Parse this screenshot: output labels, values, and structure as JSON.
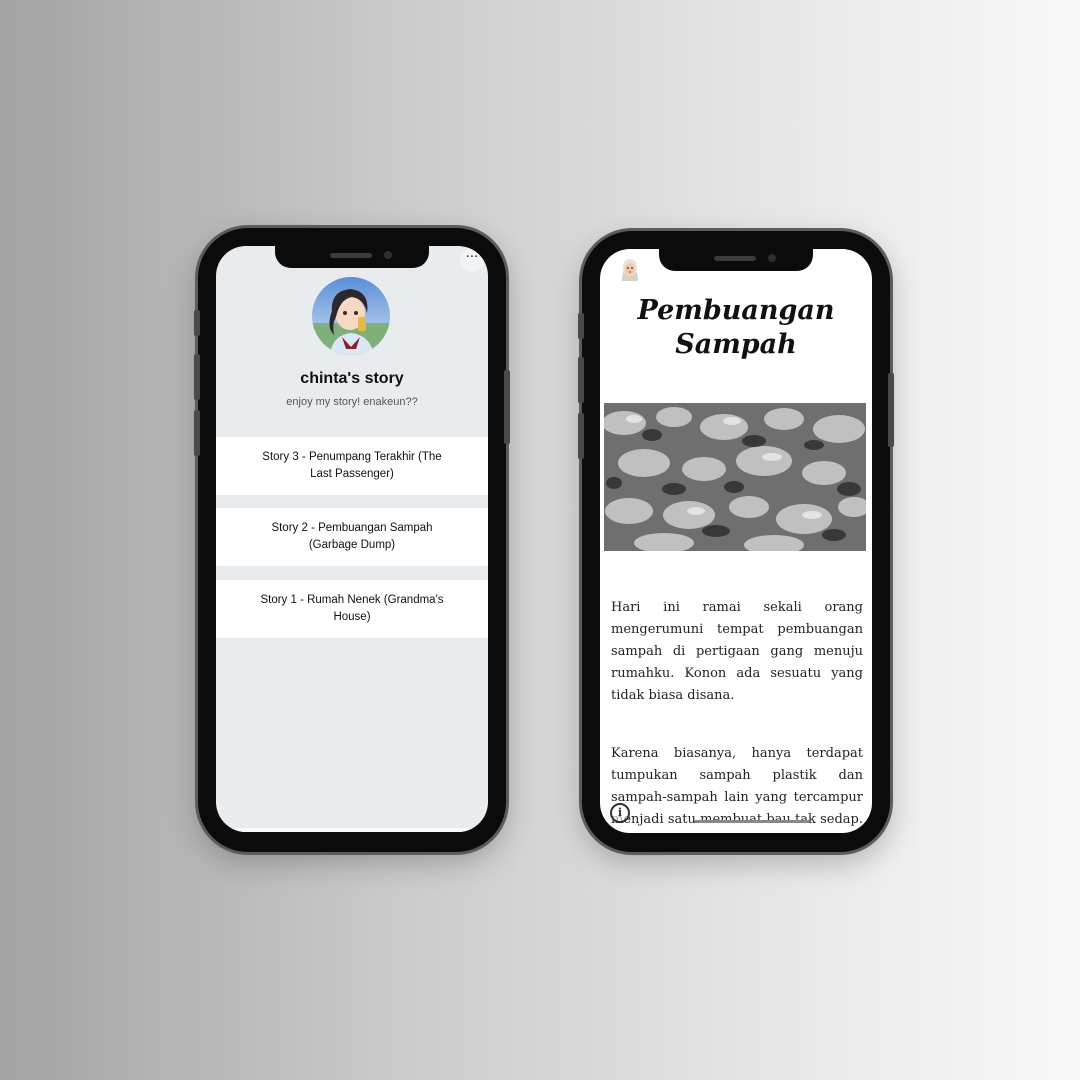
{
  "left_phone": {
    "more_button": "···",
    "profile": {
      "name": "chinta's story",
      "bio": "enjoy my story! enakeun??"
    },
    "links": [
      {
        "label": "Story 3 - Penumpang Terakhir (The Last Passenger)"
      },
      {
        "label": "Story 2 - Pembuangan Sampah (Garbage Dump)"
      },
      {
        "label": "Story 1 - Rumah Nenek (Grandma's House)"
      }
    ]
  },
  "right_phone": {
    "article": {
      "title_line1": "Pembuangan",
      "title_line2": "Sampah",
      "paragraphs": [
        "Hari ini ramai sekali orang mengerumuni tempat pembuangan sampah di pertigaan gang menuju rumahku. Konon ada sesuatu yang tidak biasa disana.",
        "Karena biasanya, hanya terdapat tumpukan sampah plastik dan sampah-sampah lain yang tercampur menjadi satu membuat bau tak sedap. Kini"
      ]
    },
    "info_icon_glyph": "i"
  },
  "icons": [
    "more-icon",
    "avatar-illustration",
    "memoji-icon",
    "info-icon"
  ],
  "colors": {
    "screen_bg_left": "#e9ecef",
    "card_bg": "#ffffff",
    "phone_frame": "#0b0b0b"
  }
}
